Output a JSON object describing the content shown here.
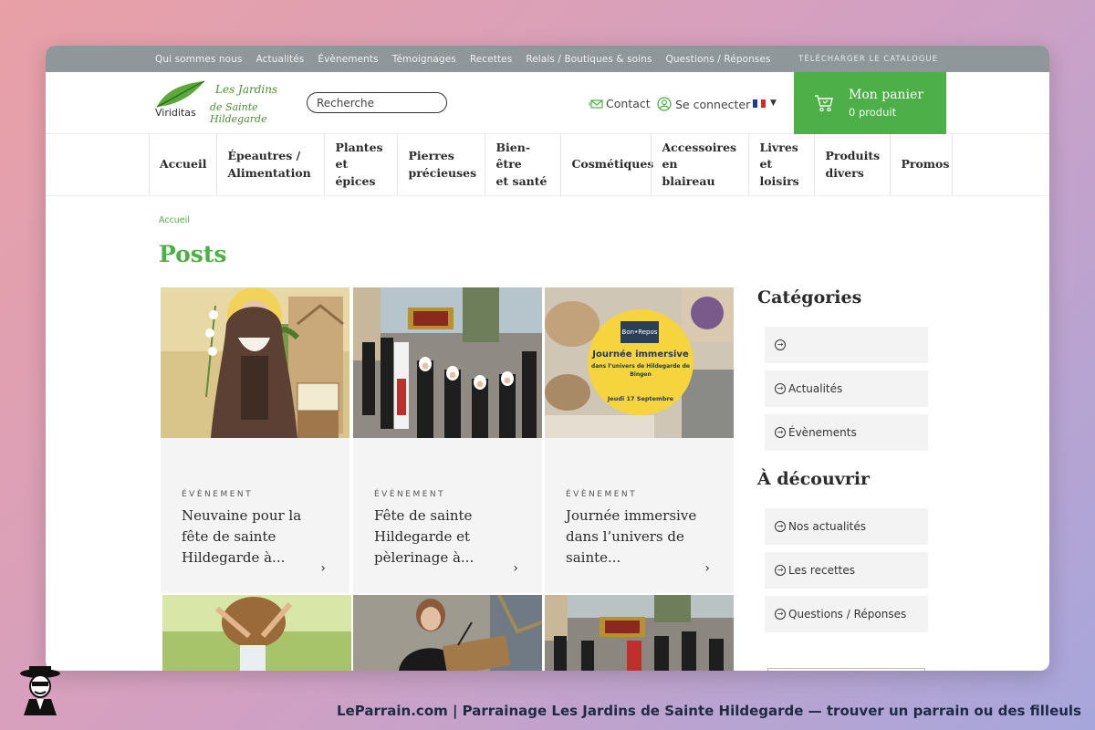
{
  "topbar": {
    "links": [
      "Qui sommes nous",
      "Actualités",
      "Évènements",
      "Témoignages",
      "Recettes",
      "Relais / Boutiques & soins",
      "Questions / Réponses"
    ],
    "catalog": "TÉLÉCHARGER LE CATALOGUE"
  },
  "header": {
    "logo_brand": "Viriditas",
    "logo_line1": "Les Jardins",
    "logo_line2": "de Sainte Hildegarde",
    "search_placeholder": "Recherche",
    "contact": "Contact",
    "login": "Se connecter",
    "cart_title": "Mon panier",
    "cart_count": "0 produit"
  },
  "nav": [
    [
      "Accueil"
    ],
    [
      "Épeautres /",
      "Alimentation"
    ],
    [
      "Plantes",
      "et épices"
    ],
    [
      "Pierres",
      "précieuses"
    ],
    [
      "Bien-être",
      "et santé"
    ],
    [
      "Cosmétiques"
    ],
    [
      "Accessoires en",
      "blaireau"
    ],
    [
      "Livres",
      "et loisirs"
    ],
    [
      "Produits",
      "divers"
    ],
    [
      "Promos"
    ]
  ],
  "breadcrumb": "Accueil",
  "page_title": "Posts",
  "posts": [
    {
      "tag": "ÉVÈNEMENT",
      "title": "Neuvaine pour la fête de sainte Hildegarde à..."
    },
    {
      "tag": "ÉVÈNEMENT",
      "title": "Fête de sainte Hildegarde et pèlerinage à..."
    },
    {
      "tag": "ÉVÈNEMENT",
      "title": "Journée immersive dans l’univers de sainte..."
    }
  ],
  "promo_image": {
    "brand": "Bon•Repos",
    "headline": "Journée immersive",
    "subline": "dans l’univers de Hildegarde de Bingen",
    "date": "Jeudi 17 Septembre"
  },
  "sidebar": {
    "categories_title": "Catégories",
    "categories": [
      "",
      "Actualités",
      "Évènements"
    ],
    "discover_title": "À découvrir",
    "discover": [
      "Nos actualités",
      "Les recettes",
      "Questions / Réponses"
    ]
  },
  "caption": "LeParrain.com | Parrainage Les Jardins de Sainte Hildegarde — trouver un parrain ou des filleuls",
  "colors": {
    "accent": "#4caf47",
    "topbar": "#8f979b"
  }
}
